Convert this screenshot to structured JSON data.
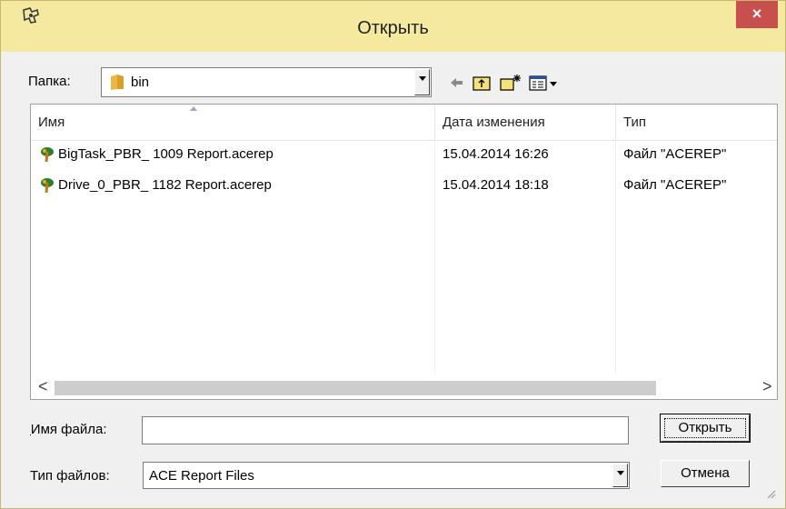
{
  "window": {
    "title": "Открыть",
    "close_glyph": "×"
  },
  "folder": {
    "label": "Папка:",
    "value": "bin"
  },
  "toolbar": {
    "icons": [
      "back-arrow-icon",
      "up-folder-icon",
      "new-folder-icon",
      "view-menu-icon"
    ]
  },
  "list": {
    "columns": [
      "Имя",
      "Дата изменения",
      "Тип"
    ],
    "rows": [
      {
        "name": "BigTask_PBR_ 1009 Report.acerep",
        "date": "15.04.2014 16:26",
        "type": "Файл \"ACEREP\""
      },
      {
        "name": "Drive_0_PBR_ 1182 Report.acerep",
        "date": "15.04.2014 18:18",
        "type": "Файл \"ACEREP\""
      }
    ],
    "scroll_left": "<",
    "scroll_right": ">"
  },
  "filename": {
    "label": "Имя файла:",
    "value": ""
  },
  "filetype": {
    "label": "Тип файлов:",
    "value": "ACE Report Files"
  },
  "buttons": {
    "open": "Открыть",
    "cancel": "Отмена"
  },
  "colors": {
    "titlebar": "#f5e9a0",
    "close": "#c7504f",
    "dialog_bg": "#f0f0f0"
  }
}
